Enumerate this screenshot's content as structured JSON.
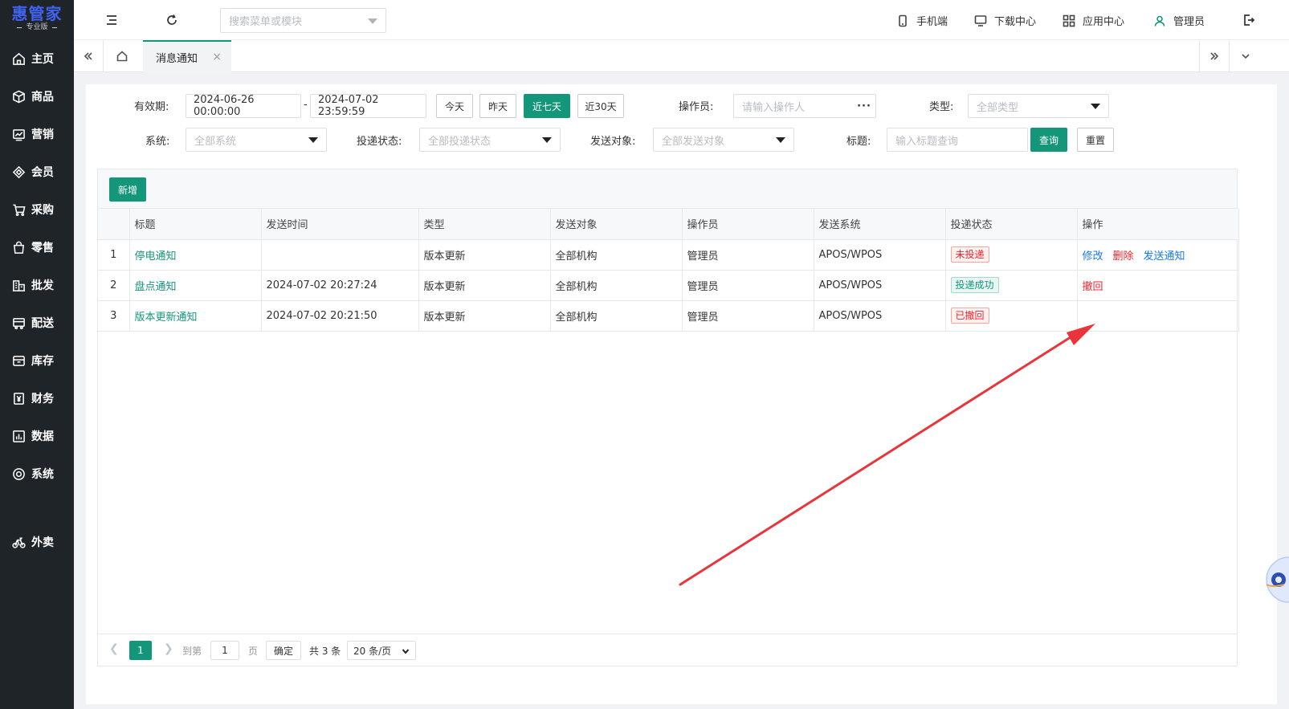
{
  "logo": {
    "main": "惠管家",
    "sub": "专业版"
  },
  "sidebar": {
    "items": [
      {
        "label": "主页",
        "icon": "home-icon"
      },
      {
        "label": "商品",
        "icon": "box-icon"
      },
      {
        "label": "营销",
        "icon": "chart-card-icon"
      },
      {
        "label": "会员",
        "icon": "diamond-icon"
      },
      {
        "label": "采购",
        "icon": "cart-icon"
      },
      {
        "label": "零售",
        "icon": "bag-icon"
      },
      {
        "label": "批发",
        "icon": "buildings-icon"
      },
      {
        "label": "配送",
        "icon": "truck-icon"
      },
      {
        "label": "库存",
        "icon": "warehouse-icon"
      },
      {
        "label": "财务",
        "icon": "yen-icon"
      },
      {
        "label": "数据",
        "icon": "bar-chart-icon"
      },
      {
        "label": "系统",
        "icon": "settings-icon"
      },
      {
        "label": "外卖",
        "icon": "bike-icon"
      }
    ]
  },
  "header": {
    "search_placeholder": "搜索菜单或模块",
    "links": {
      "mobile": "手机端",
      "download": "下载中心",
      "apps": "应用中心",
      "user": "管理员"
    }
  },
  "tabs": {
    "active": "消息通知",
    "close": "×"
  },
  "filters": {
    "validity_label": "有效期:",
    "date_start": "2024-06-26 00:00:00",
    "date_sep": "-",
    "date_end": "2024-07-02 23:59:59",
    "quick": {
      "today": "今天",
      "yesterday": "昨天",
      "last7": "近七天",
      "last30": "近30天"
    },
    "operator_label": "操作员:",
    "operator_placeholder": "请输入操作人",
    "operator_more": "···",
    "type_label": "类型:",
    "type_value": "全部类型",
    "system_label": "系统:",
    "system_value": "全部系统",
    "status_label": "投递状态:",
    "status_value": "全部投递状态",
    "target_label": "发送对象:",
    "target_value": "全部发送对象",
    "title_label": "标题:",
    "title_placeholder": "输入标题查询",
    "query": "查询",
    "reset": "重置"
  },
  "toolbar": {
    "add": "新增"
  },
  "table": {
    "headers": [
      "",
      "标题",
      "发送时间",
      "类型",
      "发送对象",
      "操作员",
      "发送系统",
      "投递状态",
      "操作"
    ],
    "rows": [
      {
        "no": "1",
        "title": "停电通知",
        "time": "",
        "type": "版本更新",
        "target": "全部机构",
        "operator": "管理员",
        "system": "APOS/WPOS",
        "status": "未投递",
        "status_color": "#f5222d",
        "ops": [
          {
            "label": "修改",
            "color": "#1677ff"
          },
          {
            "label": "删除",
            "color": "#f5222d"
          },
          {
            "label": "发送通知",
            "color": "#1677ff"
          }
        ]
      },
      {
        "no": "2",
        "title": "盘点通知",
        "time": "2024-07-02 20:27:24",
        "type": "版本更新",
        "target": "全部机构",
        "operator": "管理员",
        "system": "APOS/WPOS",
        "status": "投递成功",
        "status_color": "#14967a",
        "ops": [
          {
            "label": "撤回",
            "color": "#f5222d"
          }
        ]
      },
      {
        "no": "3",
        "title": "版本更新通知",
        "time": "2024-07-02 20:21:50",
        "type": "版本更新",
        "target": "全部机构",
        "operator": "管理员",
        "system": "APOS/WPOS",
        "status": "已撤回",
        "status_color": "#f5222d",
        "ops": []
      }
    ]
  },
  "pager": {
    "current": "1",
    "goto_label": "到第",
    "goto_value": "1",
    "page_label": "页",
    "confirm": "确定",
    "total": "共 3 条",
    "page_size": "20 条/页"
  },
  "colors": {
    "primary": "#14967a",
    "sidebar_bg": "#1f2429",
    "logo": "#3f63f0",
    "arrow": "#e8343a"
  }
}
